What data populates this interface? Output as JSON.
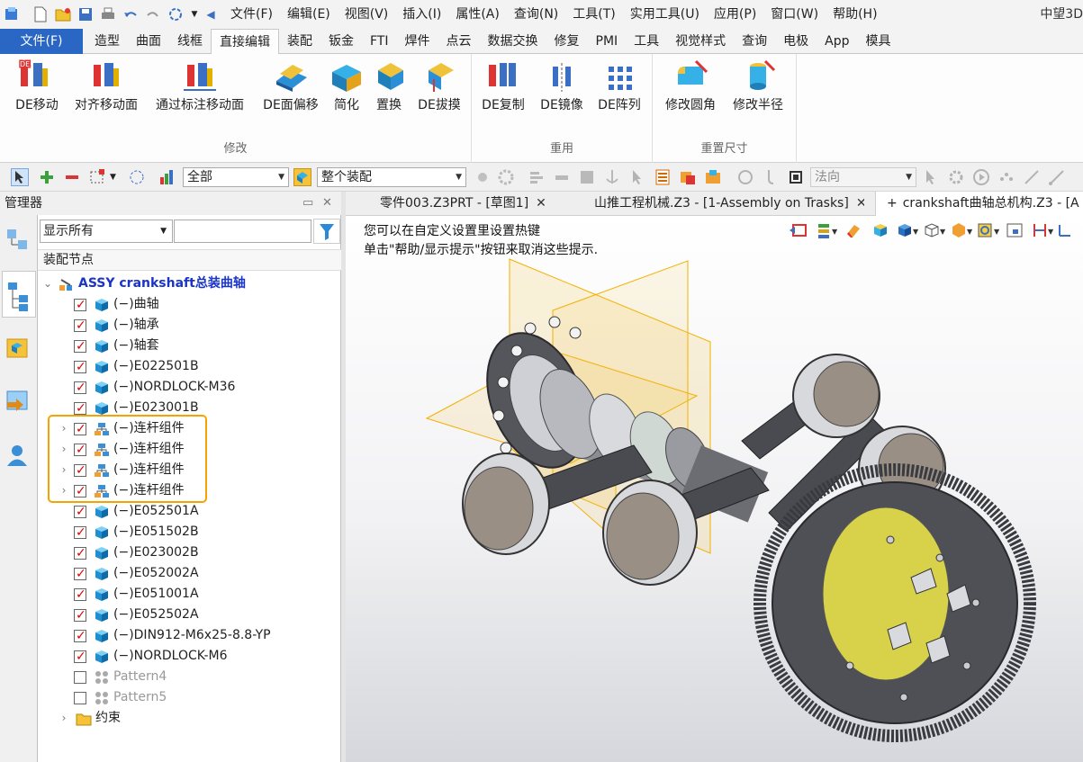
{
  "menubar": {
    "items": [
      "文件(F)",
      "编辑(E)",
      "视图(V)",
      "插入(I)",
      "属性(A)",
      "查询(N)",
      "工具(T)",
      "实用工具(U)",
      "应用(P)",
      "窗口(W)",
      "帮助(H)"
    ],
    "brand": "中望3D"
  },
  "ribbon_tabs": {
    "file": "文件(F)",
    "tabs": [
      "造型",
      "曲面",
      "线框",
      "直接编辑",
      "装配",
      "钣金",
      "FTI",
      "焊件",
      "点云",
      "数据交换",
      "修复",
      "PMI",
      "工具",
      "视觉样式",
      "查询",
      "电极",
      "App",
      "模具"
    ],
    "active_index": 3
  },
  "ribbon": {
    "groups": [
      {
        "label": "修改",
        "buttons": [
          "DE移动",
          "对齐移动面",
          "通过标注移动面",
          "DE面偏移",
          "简化",
          "置换",
          "DE拔摸"
        ]
      },
      {
        "label": "重用",
        "buttons": [
          "DE复制",
          "DE镜像",
          "DE阵列"
        ]
      },
      {
        "label": "重置尺寸",
        "buttons": [
          "修改圆角",
          "修改半径"
        ]
      }
    ]
  },
  "toolbar2": {
    "filter_value": "全部",
    "scope_value": "整个装配",
    "direction_value": "法向"
  },
  "manager": {
    "title": "管理器",
    "filter_combo": "显示所有",
    "filter_input": "",
    "column_header": "装配节点",
    "tree": [
      {
        "label": "ASSY crankshaft总装曲轴",
        "kind": "root"
      },
      {
        "label": "(−)曲轴",
        "kind": "part",
        "checked": true
      },
      {
        "label": "(−)轴承",
        "kind": "part",
        "checked": true
      },
      {
        "label": "(−)轴套",
        "kind": "part",
        "checked": true
      },
      {
        "label": "(−)E022501B",
        "kind": "part",
        "checked": true
      },
      {
        "label": "(−)NORDLOCK-M36",
        "kind": "part",
        "checked": true
      },
      {
        "label": "(−)E023001B",
        "kind": "part",
        "checked": true
      },
      {
        "label": "(−)连杆组件",
        "kind": "sub",
        "checked": true
      },
      {
        "label": "(−)连杆组件",
        "kind": "sub",
        "checked": true
      },
      {
        "label": "(−)连杆组件",
        "kind": "sub",
        "checked": true
      },
      {
        "label": "(−)连杆组件",
        "kind": "sub",
        "checked": true
      },
      {
        "label": "(−)E052501A",
        "kind": "part",
        "checked": true
      },
      {
        "label": "(−)E051502B",
        "kind": "part",
        "checked": true
      },
      {
        "label": "(−)E023002B",
        "kind": "part",
        "checked": true
      },
      {
        "label": "(−)E052002A",
        "kind": "part",
        "checked": true
      },
      {
        "label": "(−)E051001A",
        "kind": "part",
        "checked": true
      },
      {
        "label": "(−)E052502A",
        "kind": "part",
        "checked": true
      },
      {
        "label": "(−)DIN912-M6x25-8.8-YP",
        "kind": "part",
        "checked": true
      },
      {
        "label": "(−)NORDLOCK-M6",
        "kind": "part",
        "checked": true
      },
      {
        "label": "Pattern4",
        "kind": "pattern",
        "checked": false
      },
      {
        "label": "Pattern5",
        "kind": "pattern",
        "checked": false
      },
      {
        "label": "约束",
        "kind": "folder"
      }
    ]
  },
  "doc_tabs": [
    {
      "label": "零件003.Z3PRT - [草图1]",
      "active": false
    },
    {
      "label": "山推工程机械.Z3 - [1-Assembly on Trasks]",
      "active": false
    },
    {
      "label": "crankshaft曲轴总机构.Z3 - [A",
      "active": true
    }
  ],
  "viewport": {
    "hint_line1": "您可以在自定义设置里设置热键",
    "hint_line2": "单击\"帮助/显示提示\"按钮来取消这些提示."
  },
  "colors": {
    "accent": "#2a66c4",
    "highlight": "#f5a300",
    "root_text": "#1a34c8"
  }
}
